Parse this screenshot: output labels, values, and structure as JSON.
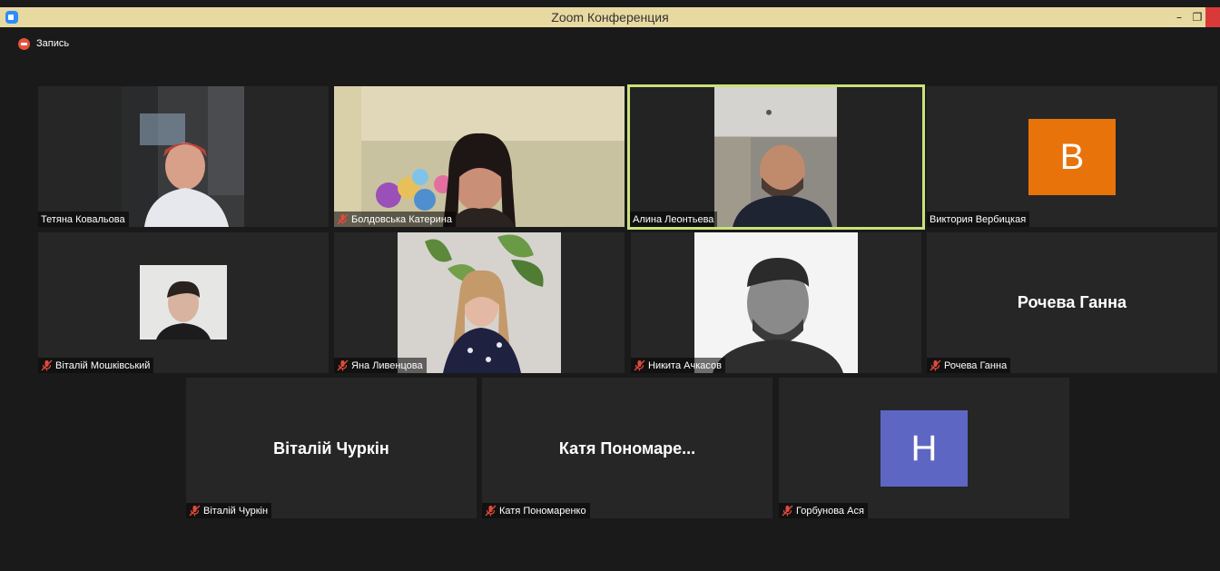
{
  "window": {
    "title": "Zoom Конференция"
  },
  "recording": {
    "label": "Запись"
  },
  "tiles": [
    {
      "name": "Тетяна Ковальова",
      "muted": false,
      "active": false,
      "kind": "video"
    },
    {
      "name": "Болдовська Катерина",
      "muted": true,
      "active": false,
      "kind": "video"
    },
    {
      "name": "Алина Леонтьева",
      "muted": false,
      "active": true,
      "kind": "video"
    },
    {
      "name": "Виктория Вербицкая",
      "muted": false,
      "active": false,
      "kind": "avatar",
      "avatar_letter": "В",
      "avatar_color": "#e8730b"
    },
    {
      "name": "Віталій Мошківський",
      "muted": true,
      "active": false,
      "kind": "video"
    },
    {
      "name": "Яна Ливенцова",
      "muted": true,
      "active": false,
      "kind": "video"
    },
    {
      "name": "Никита Ачкасов",
      "muted": true,
      "active": false,
      "kind": "video"
    },
    {
      "name": "Рочева Ганна",
      "muted": true,
      "active": false,
      "kind": "name",
      "display_name": "Рочева Ганна"
    },
    {
      "name": "Віталій Чуркін",
      "muted": true,
      "active": false,
      "kind": "name",
      "display_name": "Віталій Чуркін"
    },
    {
      "name": "Катя Пономаренко",
      "muted": true,
      "active": false,
      "kind": "name",
      "display_name": "Катя  Пономаре..."
    },
    {
      "name": "Горбунова Ася",
      "muted": true,
      "active": false,
      "kind": "avatar",
      "avatar_letter": "Н",
      "avatar_color": "#5e66c4"
    }
  ],
  "colors": {
    "active_border": "#c9e27a",
    "muted_icon": "#e04a3a",
    "background": "#1a1a1a"
  }
}
